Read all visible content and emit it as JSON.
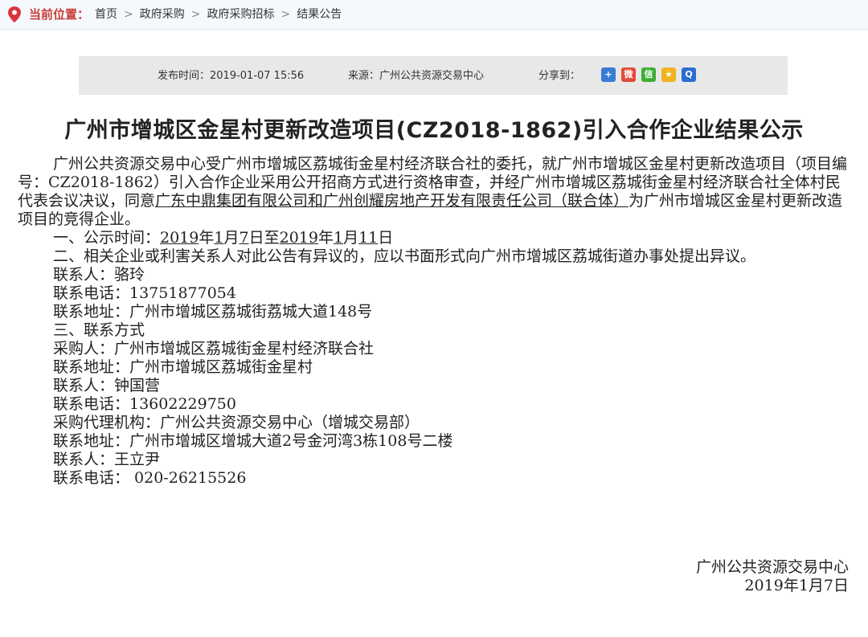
{
  "breadcrumb": {
    "label": "当前位置：",
    "items": [
      "首页",
      "政府采购",
      "政府采购招标",
      "结果公告"
    ],
    "separator": ">"
  },
  "meta": {
    "publish": "发布时间：2019-01-07 15:56",
    "source": "来源：广州公共资源交易中心",
    "share": "分享到："
  },
  "share_icons": [
    {
      "name": "add-share-icon",
      "color": "#3a7bd5",
      "glyph": "+"
    },
    {
      "name": "weibo-icon",
      "color": "#e34a3a",
      "glyph": "微"
    },
    {
      "name": "wechat-icon",
      "color": "#3cb034",
      "glyph": "信"
    },
    {
      "name": "qzone-icon",
      "color": "#f2b31d",
      "glyph": "★"
    },
    {
      "name": "qq-icon",
      "color": "#2b6fd0",
      "glyph": "Q"
    }
  ],
  "title": "广州市增城区金星村更新改造项目(CZ2018-1862)引入合作企业结果公示",
  "body": {
    "p1_a": "广州公共资源交易中心受广州市增城区荔城街金星村经济联合社的委托，就广州市增城区金星村更新改造项目（项目编号：CZ2018-1862）引入合作企业采用公开招商方式进行资格审查，并经广州市增城区荔城街金星村经济联合社全体村民代表会议决议，同意",
    "p1_u": "广东中鼎集团有限公司和广州创耀房地产开发有限责任公司（联合体）",
    "p1_b": "为广州市增城区金星村更新改造项目的竞得企业。",
    "l1_a": "一、公示时间：",
    "l1_u1": "2019",
    "l1_b": "年",
    "l1_u2": "1",
    "l1_c": "月",
    "l1_u3": "7",
    "l1_d": "日至",
    "l1_u4": "2019",
    "l1_e": "年",
    "l1_u5": "1",
    "l1_f": "月",
    "l1_u6": "11",
    "l1_g": "日",
    "l2": "二、相关企业或利害关系人对此公告有异议的，应以书面形式向广州市增城区荔城街道办事处提出异议。",
    "lines": [
      "联系人：骆玲",
      "联系电话：13751877054",
      "联系地址：广州市增城区荔城街荔城大道148号",
      "三、联系方式",
      "采购人：广州市增城区荔城街金星村经济联合社",
      "联系地址：广州市增城区荔城街金星村",
      "联系人：钟国营",
      "联系电话：13602229750",
      "采购代理机构：广州公共资源交易中心（增城交易部）",
      "联系地址：广州市增城区增城大道2号金河湾3栋108号二楼",
      "联系人：王立尹",
      "联系电话： 020-26215526"
    ]
  },
  "signature": {
    "org": "广州公共资源交易中心",
    "date": "2019年1月7日"
  }
}
